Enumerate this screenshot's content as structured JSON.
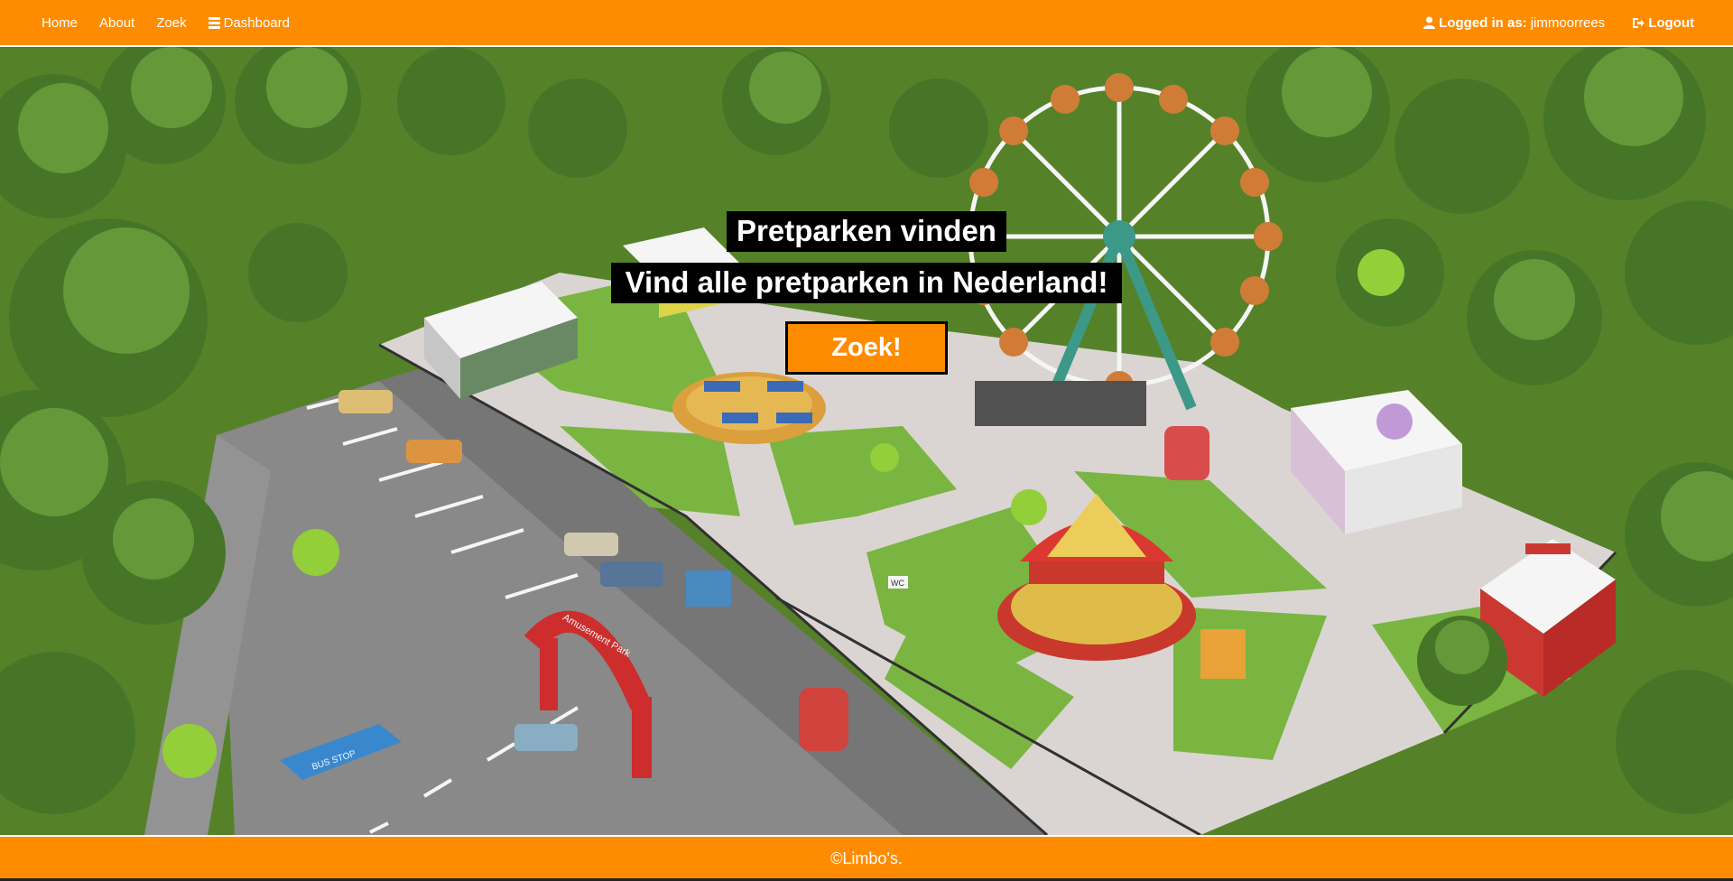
{
  "nav": {
    "home": "Home",
    "about": "About",
    "zoek": "Zoek",
    "dashboard": "Dashboard",
    "logged_in_label": "Logged in as:",
    "username": "jimmoorrees",
    "logout": "Logout"
  },
  "hero": {
    "title": "Pretparken vinden",
    "subtitle": "Vind alle pretparken in Nederland!",
    "button": "Zoek!",
    "arch_text": "Amusement Park",
    "bus_stop_text": "BUS STOP",
    "wc_sign": "WC"
  },
  "footer": {
    "copyright": "©Limbo's."
  },
  "colors": {
    "brand_orange": "#ff8c00",
    "text_white": "#ffffff",
    "title_bg": "#000000"
  },
  "icons": [
    "dashboard-icon",
    "user-icon",
    "logout-icon"
  ]
}
